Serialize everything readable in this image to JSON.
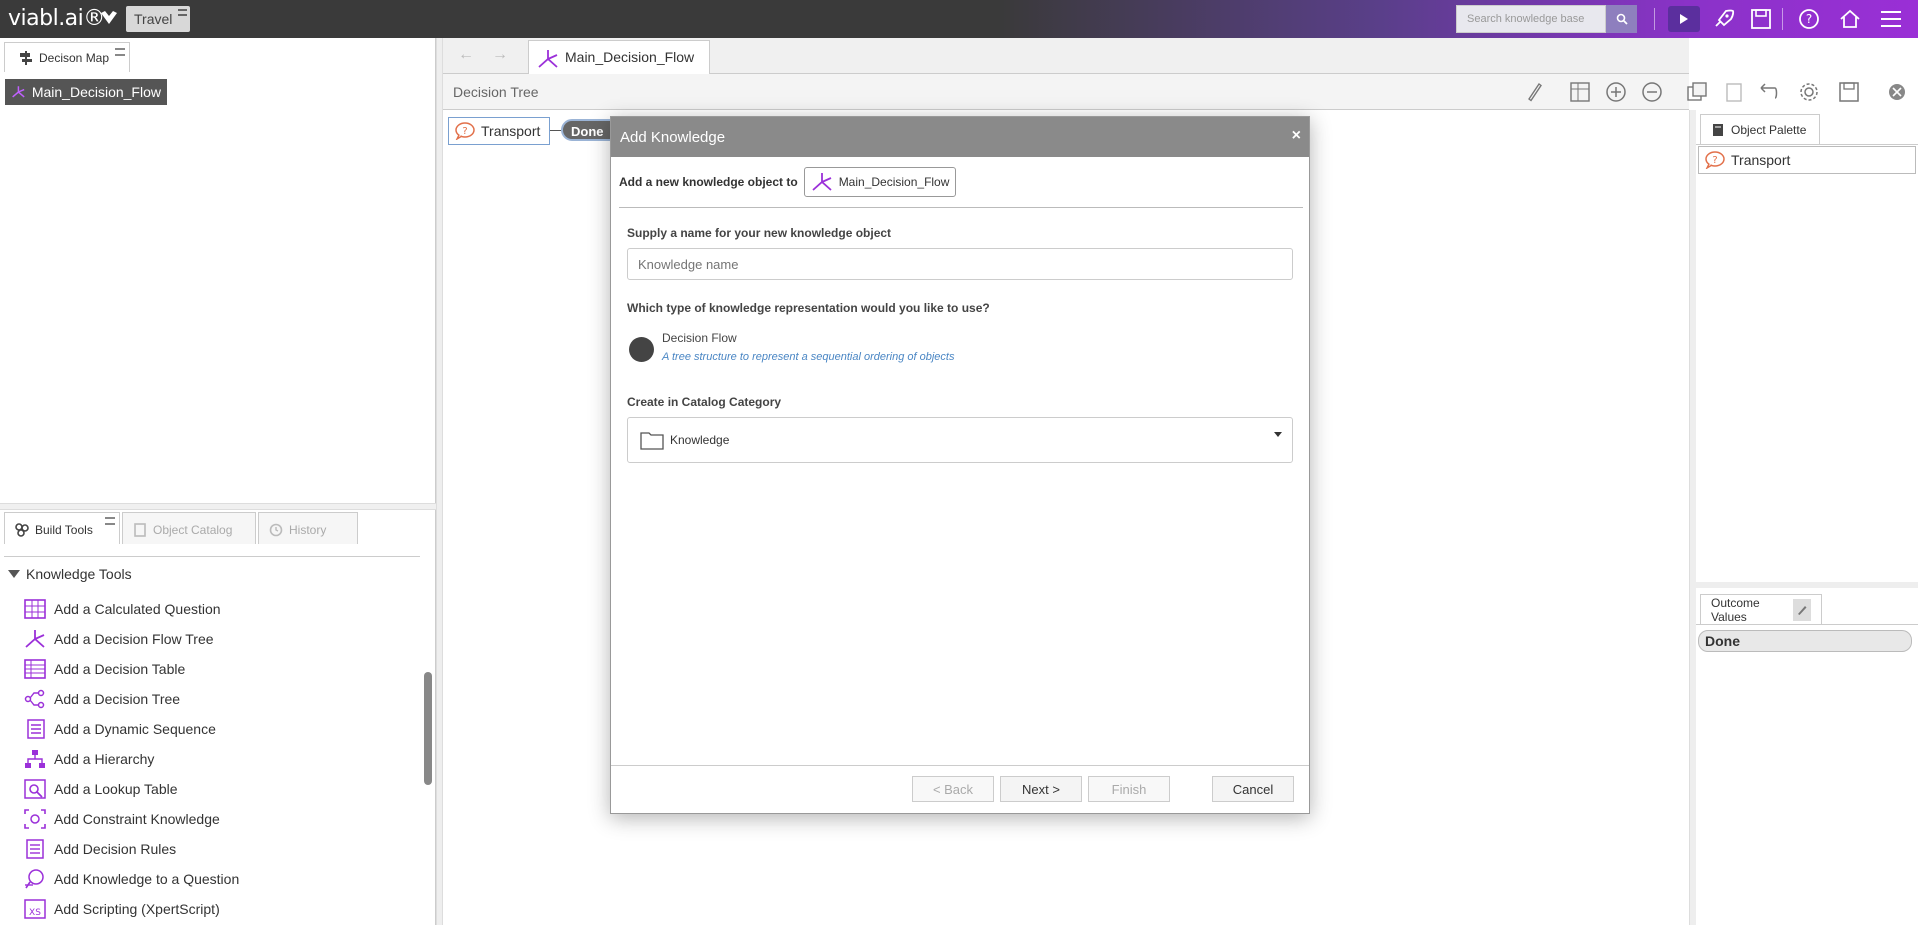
{
  "app": {
    "logo": "viabl.ai®",
    "kb_name": "Travel"
  },
  "search": {
    "placeholder": "Search knowledge base"
  },
  "left_top": {
    "tab_label": "Decison Map",
    "tree_item": "Main_Decision_Flow"
  },
  "left_bottom": {
    "tabs": [
      "Build Tools",
      "Object Catalog",
      "History"
    ],
    "section": "Knowledge Tools",
    "tools": [
      {
        "label": "Add a Calculated Question",
        "icon": "calculated-question-icon"
      },
      {
        "label": "Add a Decision Flow Tree",
        "icon": "decision-flow-icon"
      },
      {
        "label": "Add a Decision Table",
        "icon": "decision-table-icon"
      },
      {
        "label": "Add a Decision Tree",
        "icon": "decision-tree-icon"
      },
      {
        "label": "Add a Dynamic Sequence",
        "icon": "dynamic-sequence-icon"
      },
      {
        "label": "Add a Hierarchy",
        "icon": "hierarchy-icon"
      },
      {
        "label": "Add a Lookup Table",
        "icon": "lookup-table-icon"
      },
      {
        "label": "Add Constraint Knowledge",
        "icon": "constraint-icon"
      },
      {
        "label": "Add Decision Rules",
        "icon": "decision-rules-icon"
      },
      {
        "label": "Add Knowledge to a Question",
        "icon": "knowledge-question-icon"
      },
      {
        "label": "Add Scripting (XpertScript)",
        "icon": "scripting-icon"
      }
    ]
  },
  "center": {
    "doc_tab": "Main_Decision_Flow",
    "toolbar_label": "Decision Tree",
    "nodes": {
      "transport": "Transport",
      "done": "Done"
    }
  },
  "right": {
    "palette_tab": "Object Palette",
    "palette_item": "Transport",
    "outcome_tab": "Outcome Values",
    "outcome_item": "Done"
  },
  "modal": {
    "title": "Add Knowledge",
    "close": "×",
    "add_to_label": "Add a new knowledge object to",
    "add_to_target": "Main_Decision_Flow",
    "name_label": "Supply a name for your new knowledge object",
    "name_placeholder": "Knowledge name",
    "type_label": "Which type of knowledge representation would you like to use?",
    "type_option": "Decision Flow",
    "type_desc": "A tree structure to represent a sequential ordering of objects",
    "category_label": "Create in Catalog Category",
    "category_value": "Knowledge",
    "buttons": {
      "back": "< Back",
      "next": "Next >",
      "finish": "Finish",
      "cancel": "Cancel"
    }
  }
}
